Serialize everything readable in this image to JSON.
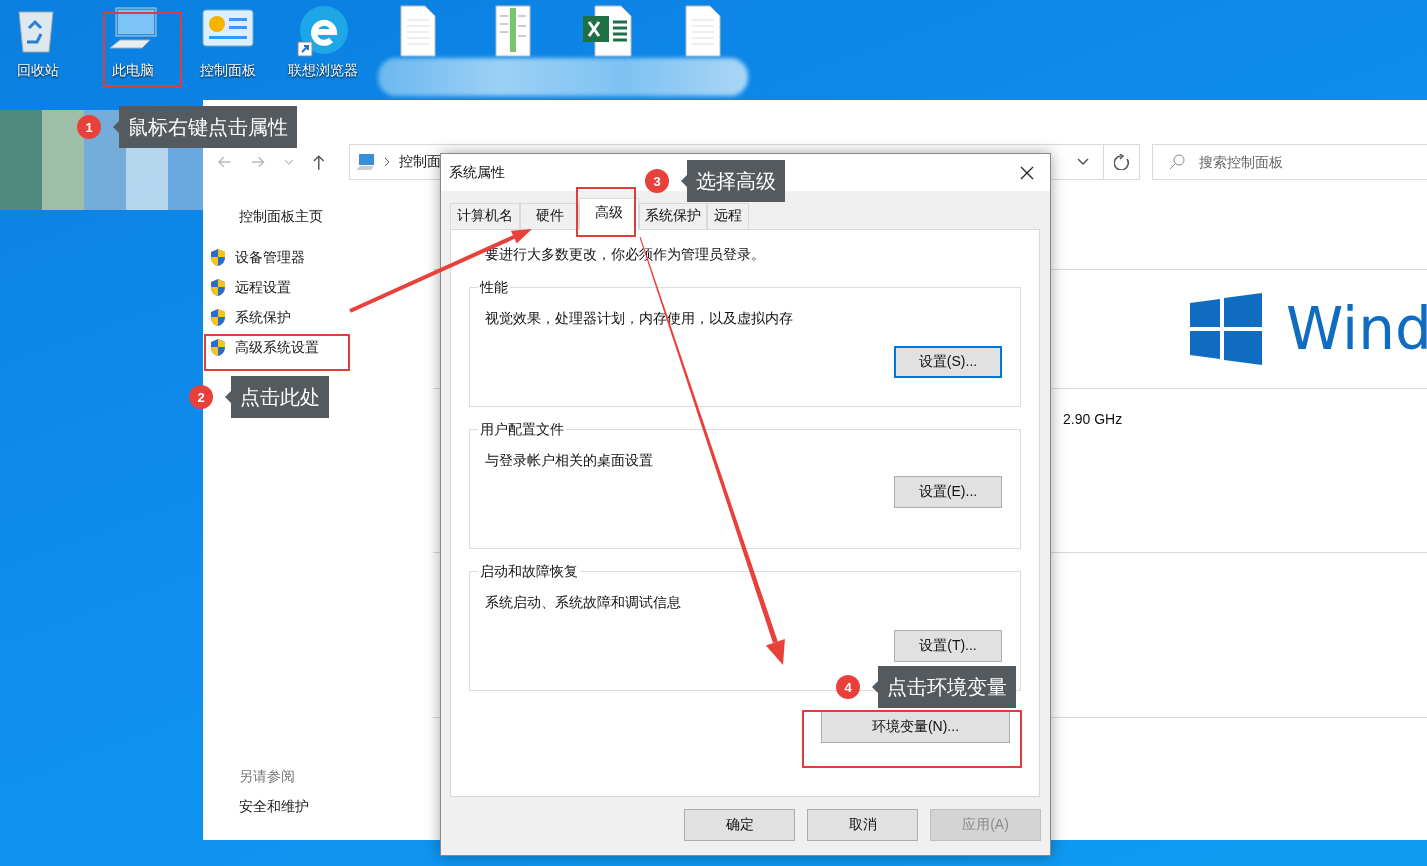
{
  "desktop": {
    "icons": [
      {
        "kind": "recycle-bin",
        "label": "回收站"
      },
      {
        "kind": "computer",
        "label": "此电脑"
      },
      {
        "kind": "control-panel",
        "label": "控制面板"
      },
      {
        "kind": "browser",
        "label": "联想浏览器"
      },
      {
        "kind": "document"
      },
      {
        "kind": "image-document"
      },
      {
        "kind": "spreadsheet"
      },
      {
        "kind": "document"
      }
    ]
  },
  "control_panel": {
    "breadcrumb": "控制面",
    "search": {
      "placeholder": "搜索控制面板"
    },
    "sidebar": {
      "home": "控制面板主页",
      "items": [
        "设备管理器",
        "远程设置",
        "系统保护",
        "高级系统设置"
      ],
      "see_also_heading": "另请参阅",
      "see_also": [
        "安全和维护"
      ]
    },
    "logo_text": "Wind",
    "processor_speed": "2.90 GHz"
  },
  "dialog": {
    "title": "系统属性",
    "tabs": [
      {
        "label": "计算机名",
        "selected": false
      },
      {
        "label": "硬件",
        "selected": false
      },
      {
        "label": "高级",
        "selected": true
      },
      {
        "label": "系统保护",
        "selected": false
      },
      {
        "label": "远程",
        "selected": false
      }
    ],
    "admin_note": "要进行大多数更改，你必须作为管理员登录。",
    "groups": [
      {
        "title": "性能",
        "description": "视觉效果，处理器计划，内存使用，以及虚拟内存",
        "button": "设置(S)...",
        "focused": true
      },
      {
        "title": "用户配置文件",
        "description": "与登录帐户相关的桌面设置",
        "button": "设置(E)...",
        "focused": false
      },
      {
        "title": "启动和故障恢复",
        "description": "系统启动、系统故障和调试信息",
        "button": "设置(T)...",
        "focused": false
      }
    ],
    "env_button": "环境变量(N)...",
    "buttons": [
      {
        "label": "确定",
        "disabled": false
      },
      {
        "label": "取消",
        "disabled": false
      },
      {
        "label": "应用(A)",
        "disabled": true
      }
    ]
  },
  "annotations": [
    {
      "number": "1",
      "text": "鼠标右键点击属性"
    },
    {
      "number": "2",
      "text": "点击此处"
    },
    {
      "number": "3",
      "text": "选择高级"
    },
    {
      "number": "4",
      "text": "点击环境变量"
    }
  ]
}
